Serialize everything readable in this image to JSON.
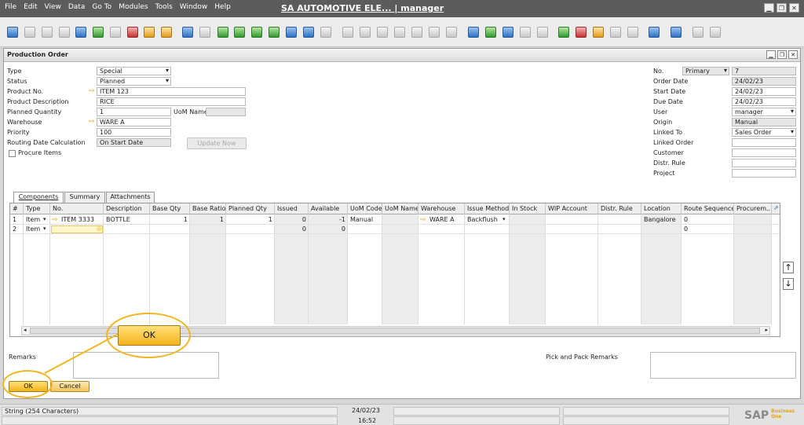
{
  "menubar": {
    "menus": [
      "File",
      "Edit",
      "View",
      "Data",
      "Go To",
      "Modules",
      "Tools",
      "Window",
      "Help"
    ],
    "title": "SA AUTOMOTIVE ELE... | manager"
  },
  "form": {
    "title": "Production Order",
    "left": {
      "type_label": "Type",
      "type_value": "Special",
      "status_label": "Status",
      "status_value": "Planned",
      "product_no_label": "Product No.",
      "product_no_value": "ITEM 123",
      "product_desc_label": "Product Description",
      "product_desc_value": "RICE",
      "planned_qty_label": "Planned Quantity",
      "planned_qty_value": "1",
      "uom_name_label": "UoM Name",
      "uom_name_value": "",
      "warehouse_label": "Warehouse",
      "warehouse_value": "WARE A",
      "priority_label": "Priority",
      "priority_value": "100",
      "routing_label": "Routing Date Calculation",
      "routing_value": "On Start Date",
      "update_now_label": "Update Now",
      "procure_label": "Procure Items"
    },
    "right": {
      "no_label": "No.",
      "no_series": "Primary",
      "no_value": "7",
      "order_date_label": "Order Date",
      "order_date_value": "24/02/23",
      "start_date_label": "Start Date",
      "start_date_value": "24/02/23",
      "due_date_label": "Due Date",
      "due_date_value": "24/02/23",
      "user_label": "User",
      "user_value": "manager",
      "origin_label": "Origin",
      "origin_value": "Manual",
      "linked_to_label": "Linked To",
      "linked_to_value": "Sales Order",
      "linked_order_label": "Linked Order",
      "linked_order_value": "",
      "customer_label": "Customer",
      "customer_value": "",
      "distr_rule_label": "Distr. Rule",
      "distr_rule_value": "",
      "project_label": "Project",
      "project_value": ""
    },
    "tabs": [
      "Components",
      "Summary",
      "Attachments"
    ],
    "grid": {
      "columns": [
        "#",
        "Type",
        "No.",
        "Description",
        "Base Qty",
        "Base Ratio",
        "Planned Qty",
        "Issued",
        "Available",
        "UoM Code",
        "UoM Name",
        "Warehouse",
        "Issue Method",
        "In Stock",
        "WIP Account",
        "Distr. Rule",
        "Location",
        "Route Sequence",
        "Procurem..."
      ],
      "rows": [
        {
          "num": "1",
          "type": "Item",
          "no": "ITEM 3333",
          "desc": "BOTTLE",
          "base_qty": "1",
          "base_ratio": "1",
          "planned_qty": "1",
          "issued": "0",
          "available": "-1",
          "uom_code": "Manual",
          "warehouse": "WARE A",
          "issue_method": "Backflush",
          "location": "Bangalore",
          "route_seq": "0"
        },
        {
          "num": "2",
          "type": "Item",
          "no": "",
          "desc": "",
          "base_qty": "",
          "base_ratio": "",
          "planned_qty": "",
          "issued": "0",
          "available": "0",
          "uom_code": "",
          "warehouse": "",
          "issue_method": "",
          "location": "",
          "route_seq": "0"
        }
      ]
    },
    "remarks_label": "Remarks",
    "pick_pack_label": "Pick and Pack Remarks",
    "ok_label": "OK",
    "cancel_label": "Cancel",
    "ok_zoom_label": "OK"
  },
  "statusbar": {
    "message": "String (254 Characters)",
    "date": "24/02/23",
    "time": "16:52",
    "brand": "SAP",
    "brand_sub": "Business One"
  },
  "colors": {
    "menubar": "#5c5c5c",
    "accent": "#f2b51f",
    "ok_button": "#f3b21a"
  }
}
